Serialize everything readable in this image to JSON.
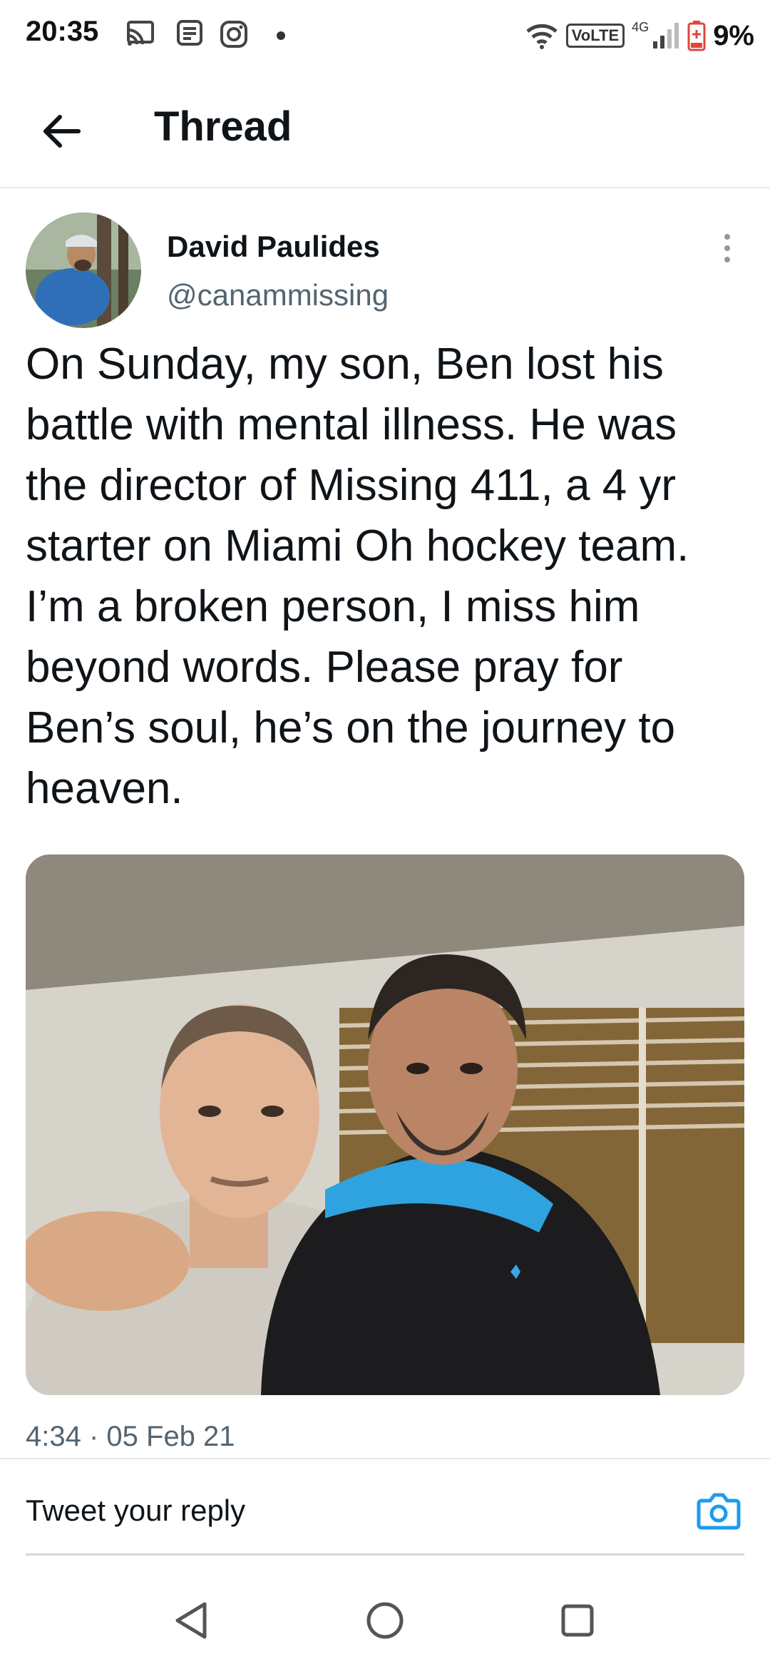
{
  "status_bar": {
    "time": "20:35",
    "network_type": "4G",
    "volte_label": "VoLTE",
    "battery_percent": "9%",
    "icons": [
      "cast-icon",
      "message-icon",
      "instagram-icon",
      "wifi-icon",
      "signal-icon",
      "battery-low-icon"
    ]
  },
  "header": {
    "title": "Thread",
    "back_icon": "arrow-left-icon"
  },
  "tweet": {
    "author_name": "David Paulides",
    "author_handle": "@canammissing",
    "text": "On Sunday, my son, Ben lost his\nbattle with mental illness. He was\nthe director of Missing 411, a 4 yr\nstarter on Miami Oh hockey team.\nI’m a broken person, I miss him\nbeyond words. Please pray for\nBen’s soul, he’s on the journey to\nheaven.",
    "timestamp": "4:34 · 05 Feb 21",
    "more_icon": "more-vertical-icon"
  },
  "reply": {
    "placeholder": "Tweet your reply",
    "camera_icon": "camera-icon"
  },
  "nav": {
    "icons": [
      "back-triangle-icon",
      "home-circle-icon",
      "recents-square-icon"
    ]
  },
  "colors": {
    "accent": "#1d9bf0",
    "text": "#0f1419",
    "secondary": "#536471",
    "divider": "#e6e9ec",
    "battery_low": "#e0453a"
  }
}
